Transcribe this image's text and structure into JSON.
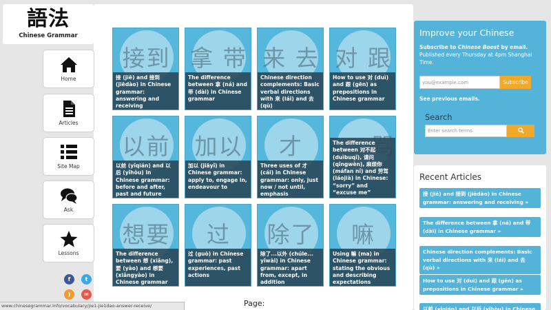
{
  "logo": {
    "chars": "語法",
    "subtitle": "Chinese Grammar"
  },
  "nav": [
    {
      "label": "Home",
      "icon": "home-icon"
    },
    {
      "label": "Articles",
      "icon": "document-icon"
    },
    {
      "label": "Site Map",
      "icon": "list-icon"
    },
    {
      "label": "Ask",
      "icon": "speech-bubbles-icon"
    },
    {
      "label": "Lessons",
      "icon": "star-icon"
    }
  ],
  "tiles": [
    {
      "watermark": "接到",
      "title": "接 (jiē) and 接到 (jiēdào) in Chinese grammar: answering and receiving"
    },
    {
      "watermark": "拿 带",
      "title": "The difference between 拿 (ná) and 带 (dài) in Chinese grammar"
    },
    {
      "watermark": "来 去",
      "title": "Chinese direction complements: Basic verbal directions with 来 (lái) and 去 (qù)"
    },
    {
      "watermark": "对 跟",
      "title": "How to use 对 (duì) and 跟 (gēn) as prepositions in Chinese grammar"
    },
    {
      "watermark": "以前",
      "title": "以前 (yǐqián) and 以后 (yǐhòu) in Chinese grammar: before and after, past and future"
    },
    {
      "watermark": "加以",
      "title": "加以 (jiāyǐ) in Chinese grammar: apply to, engage in, endeavour to"
    },
    {
      "watermark": "才",
      "title": "Three uses of 才 (cái) in Chinese grammar: only, just now / not until, emphasis"
    },
    {
      "watermark": "骂",
      "title": "The difference between 对不起 (duìbuqǐ), 请问 (qǐngwèn), 麻烦你 (máfan nǐ) and 劳驾 (láojià) in Chinese: “sorry” and “excuse me”"
    },
    {
      "watermark": "想要",
      "title": "The difference between 想 (xiǎng), 要 (yào) and 想要 (xiǎngyào) in Chinese grammar"
    },
    {
      "watermark": "过",
      "title": "过 (guò) in Chinese grammar: past experiences, past actions"
    },
    {
      "watermark": "除了",
      "title": "除了...以外 (chúle... yǐwài) in Chinese grammar: apart from, except, in addition"
    },
    {
      "watermark": "嘛",
      "title": "Using 嘛 (ma) in Chinese grammar: stating the obvious and describing expectations"
    }
  ],
  "page_label": "Page:",
  "status_url": "www.chinesegrammar.info/vocabulary/jie1-jie1dao-answer-receive/",
  "improve": {
    "heading": "Improve your Chinese",
    "subscribe_prefix": "Subscribe to ",
    "subscribe_brand": "Chinese Boost",
    "subscribe_suffix": " by email.",
    "published": "Published every Thursday at 4pm Shanghai Time.",
    "email_placeholder": "you@example.com",
    "subscribe_button": "Subscribe",
    "previous_emails": "See previous emails."
  },
  "search": {
    "heading": "Search",
    "placeholder": "Enter search terms",
    "button_icon": "search-icon"
  },
  "recent": {
    "heading": "Recent Articles",
    "links": [
      "接 (jiē) and 接到 (jiēdào) in Chinese grammar: answering and receiving »",
      "The difference between 拿 (ná) and 带 (dài) in Chinese grammar »",
      "Chinese direction complements: Basic verbal directions with 来 (lái) and 去 (qù) »",
      "How to use 对 (duì) and 跟 (gēn) as prepositions in Chinese grammar »",
      "以前 (yǐqián) and 以后 (yǐhòu) in Chinese"
    ]
  },
  "colors": {
    "accent_blue": "#54b3d9",
    "button_orange": "#f0a92a",
    "caption_dark": "#284655"
  }
}
